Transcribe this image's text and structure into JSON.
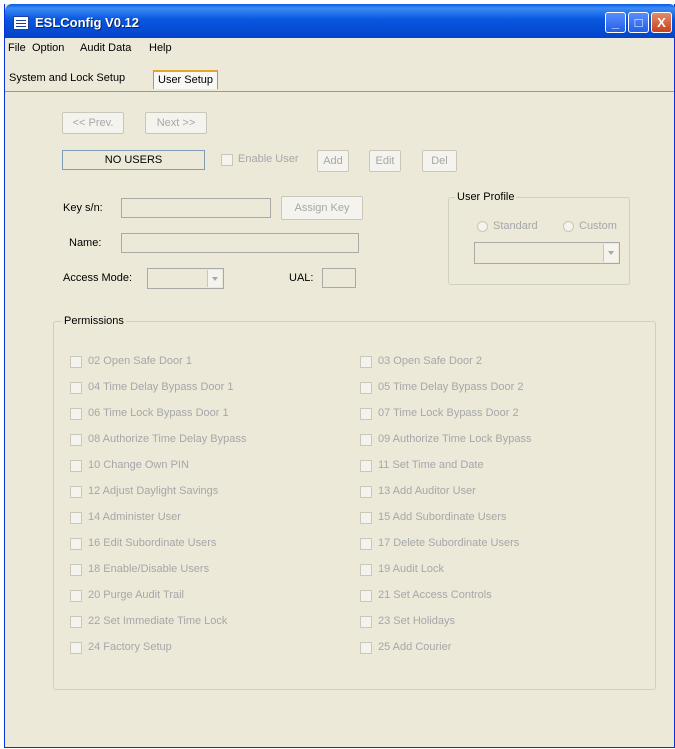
{
  "window": {
    "title": "ESLConfig V0.12",
    "controls": {
      "minimize": "_",
      "maximize": "□",
      "close": "X"
    },
    "titlebar_color": "#0a5ae3"
  },
  "menu": [
    "File",
    "Option",
    "Audit Data",
    "Help"
  ],
  "tabs": [
    {
      "label": "System and Lock Setup",
      "active": false
    },
    {
      "label": "User Setup",
      "active": true
    }
  ],
  "nav": {
    "prev": "<< Prev.",
    "next": "Next >>"
  },
  "user": {
    "status": "NO USERS",
    "enable_label": "Enable User",
    "add": "Add",
    "edit": "Edit",
    "del": "Del"
  },
  "form": {
    "key_label": "Key s/n:",
    "key_value": "",
    "assign_key": "Assign Key",
    "name_label": "Name:",
    "name_value": "",
    "access_label": "Access Mode:",
    "access_value": "",
    "ual_label": "UAL:",
    "ual_value": ""
  },
  "profile": {
    "title": "User Profile",
    "standard": "Standard",
    "custom": "Custom",
    "selected": ""
  },
  "permissions": {
    "title": "Permissions",
    "left": [
      "02  Open Safe Door 1",
      "04  Time Delay Bypass Door 1",
      "06  Time Lock Bypass Door 1",
      "08  Authorize Time Delay Bypass",
      "10  Change Own PIN",
      "12  Adjust Daylight Savings",
      "14  Administer User",
      "16  Edit Subordinate Users",
      "18  Enable/Disable Users",
      "20  Purge Audit  Trail",
      "22  Set Immediate Time Lock",
      "24  Factory Setup"
    ],
    "right": [
      "03  Open Safe Door 2",
      "05  Time Delay Bypass Door 2",
      "07  Time Lock Bypass Door 2",
      "09  Authorize Time Lock Bypass",
      "11  Set Time and Date",
      "13  Add Auditor User",
      "15  Add Subordinate Users",
      "17  Delete Subordinate Users",
      "19  Audit Lock",
      "21  Set Access Controls",
      "23  Set Holidays",
      "25   Add Courier"
    ]
  }
}
